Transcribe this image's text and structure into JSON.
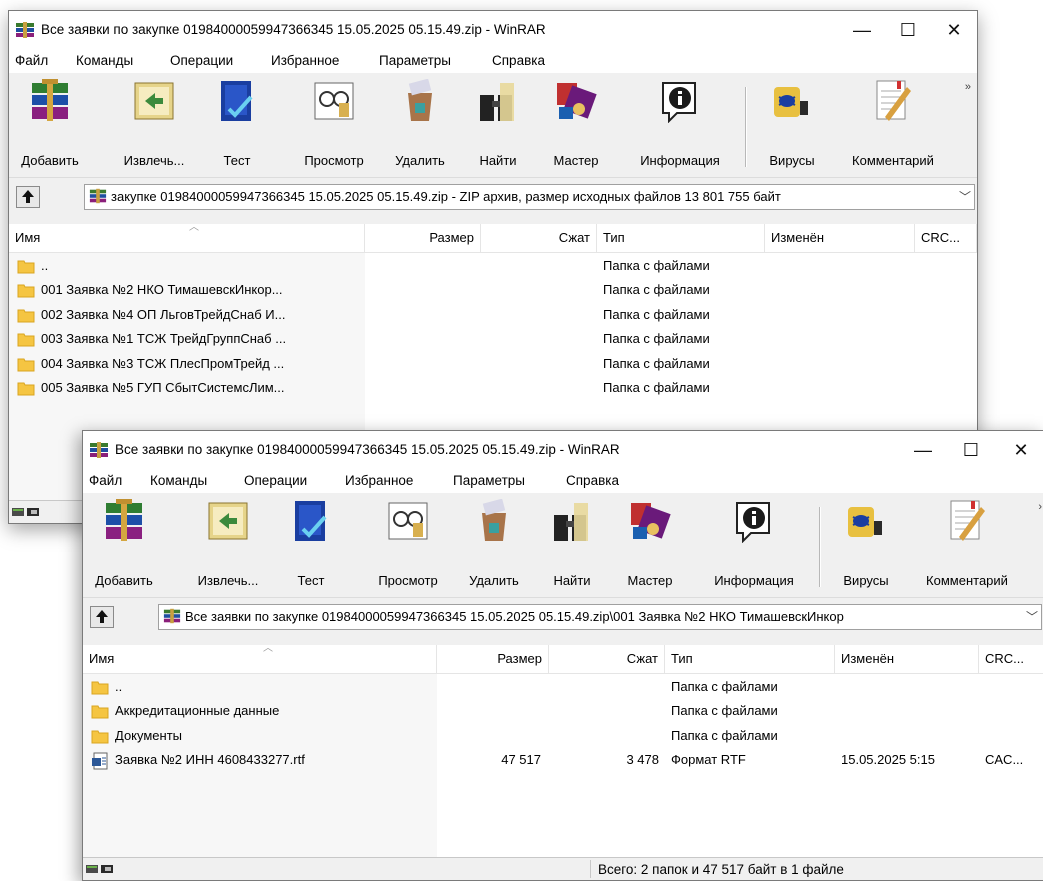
{
  "win1": {
    "title": "Все заявки по закупке 01984000059947366345 15.05.2025 05.15.49.zip - WinRAR",
    "menu": [
      "Файл",
      "Команды",
      "Операции",
      "Избранное",
      "Параметры",
      "Справка"
    ],
    "toolbar": [
      {
        "label": "Добавить",
        "icon": "add-archive-icon"
      },
      {
        "label": "Извлечь...",
        "icon": "extract-icon"
      },
      {
        "label": "Тест",
        "icon": "test-icon"
      },
      {
        "label": "Просмотр",
        "icon": "view-icon"
      },
      {
        "label": "Удалить",
        "icon": "delete-icon"
      },
      {
        "label": "Найти",
        "icon": "find-icon"
      },
      {
        "label": "Мастер",
        "icon": "wizard-icon"
      },
      {
        "label": "Информация",
        "icon": "info-icon"
      },
      {
        "label": "Вирусы",
        "icon": "virus-scan-icon"
      },
      {
        "label": "Комментарий",
        "icon": "comment-icon"
      }
    ],
    "overflow": "»",
    "address": "закупке 01984000059947366345 15.05.2025 05.15.49.zip - ZIP архив, размер исходных файлов 13 801 755 байт",
    "columns": {
      "name": "Имя",
      "size": "Размер",
      "packed": "Сжат",
      "type": "Тип",
      "modified": "Изменён",
      "crc": "CRC..."
    },
    "rows": [
      {
        "name": "..",
        "size": "",
        "packed": "",
        "type": "Папка с файлами",
        "modified": "",
        "crc": ""
      },
      {
        "name": "001 Заявка №2 НКО ТимашевскИнкор...",
        "size": "",
        "packed": "",
        "type": "Папка с файлами",
        "modified": "",
        "crc": ""
      },
      {
        "name": "002 Заявка №4 ОП ЛьговТрейдСнаб И...",
        "size": "",
        "packed": "",
        "type": "Папка с файлами",
        "modified": "",
        "crc": ""
      },
      {
        "name": "003 Заявка №1 ТСЖ ТрейдГруппСнаб ...",
        "size": "",
        "packed": "",
        "type": "Папка с файлами",
        "modified": "",
        "crc": ""
      },
      {
        "name": "004 Заявка №3 ТСЖ ПлесПромТрейд ...",
        "size": "",
        "packed": "",
        "type": "Папка с файлами",
        "modified": "",
        "crc": ""
      },
      {
        "name": "005 Заявка №5 ГУП СбытСистемсЛим...",
        "size": "",
        "packed": "",
        "type": "Папка с файлами",
        "modified": "",
        "crc": ""
      }
    ]
  },
  "win2": {
    "title": "Все заявки по закупке 01984000059947366345 15.05.2025 05.15.49.zip - WinRAR",
    "menu": [
      "Файл",
      "Команды",
      "Операции",
      "Избранное",
      "Параметры",
      "Справка"
    ],
    "toolbar": [
      {
        "label": "Добавить",
        "icon": "add-archive-icon"
      },
      {
        "label": "Извлечь...",
        "icon": "extract-icon"
      },
      {
        "label": "Тест",
        "icon": "test-icon"
      },
      {
        "label": "Просмотр",
        "icon": "view-icon"
      },
      {
        "label": "Удалить",
        "icon": "delete-icon"
      },
      {
        "label": "Найти",
        "icon": "find-icon"
      },
      {
        "label": "Мастер",
        "icon": "wizard-icon"
      },
      {
        "label": "Информация",
        "icon": "info-icon"
      },
      {
        "label": "Вирусы",
        "icon": "virus-scan-icon"
      },
      {
        "label": "Комментарий",
        "icon": "comment-icon"
      }
    ],
    "overflow": "›",
    "address": "Все заявки по закупке 01984000059947366345 15.05.2025 05.15.49.zip\\001 Заявка №2 НКО ТимашевскИнкор",
    "columns": {
      "name": "Имя",
      "size": "Размер",
      "packed": "Сжат",
      "type": "Тип",
      "modified": "Изменён",
      "crc": "CRC..."
    },
    "rows": [
      {
        "name": "..",
        "size": "",
        "packed": "",
        "type": "Папка с файлами",
        "modified": "",
        "crc": "",
        "kind": "folder"
      },
      {
        "name": "Аккредитационные данные",
        "size": "",
        "packed": "",
        "type": "Папка с файлами",
        "modified": "",
        "crc": "",
        "kind": "folder"
      },
      {
        "name": "Документы",
        "size": "",
        "packed": "",
        "type": "Папка с файлами",
        "modified": "",
        "crc": "",
        "kind": "folder"
      },
      {
        "name": "Заявка №2 ИНН 4608433277.rtf",
        "size": "47 517",
        "packed": "3 478",
        "type": "Формат RTF",
        "modified": "15.05.2025 5:15",
        "crc": "CAC...",
        "kind": "rtf"
      }
    ],
    "status": "Всего: 2 папок и 47 517 байт в 1 файле"
  },
  "colors": {
    "folder": "#f5c542",
    "window_bg": "#f0f0f0",
    "list_bg": "#ffffff"
  }
}
